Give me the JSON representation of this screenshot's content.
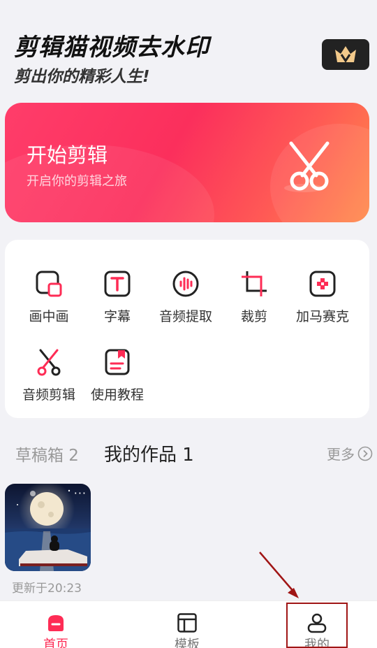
{
  "header": {
    "title": "剪辑猫视频去水印",
    "slogan": "剪出你的精彩人生!",
    "vip_icon": "crown-icon"
  },
  "hero": {
    "title": "开始剪辑",
    "subtitle": "开启你的剪辑之旅",
    "icon": "scissors-icon"
  },
  "tools": [
    {
      "label": "画中画",
      "icon": "picture-in-picture-icon"
    },
    {
      "label": "字幕",
      "icon": "subtitle-icon"
    },
    {
      "label": "音频提取",
      "icon": "audio-extract-icon"
    },
    {
      "label": "裁剪",
      "icon": "crop-icon"
    },
    {
      "label": "加马赛克",
      "icon": "mosaic-icon"
    },
    {
      "label": "音频剪辑",
      "icon": "audio-cut-icon"
    },
    {
      "label": "使用教程",
      "icon": "tutorial-icon"
    }
  ],
  "sections": {
    "drafts": "草稿箱 2",
    "works": "我的作品 1",
    "more": "更多"
  },
  "works": [
    {
      "updated": "更新于20:23"
    }
  ],
  "nav": {
    "home": "首页",
    "templates": "模板",
    "mine": "我的"
  },
  "colors": {
    "accent": "#fe2c55",
    "hero_start": "#ff3d6a",
    "hero_end": "#ff8a4a",
    "annotation": "#a01515"
  }
}
